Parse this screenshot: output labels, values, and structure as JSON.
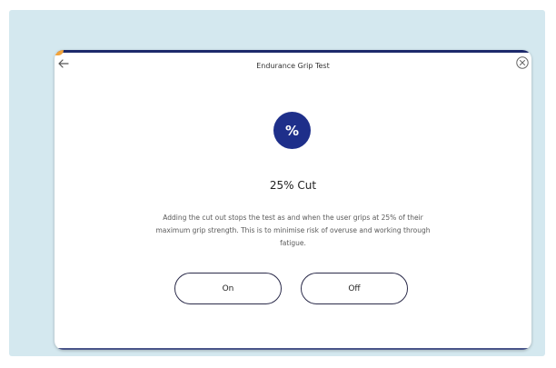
{
  "dialog": {
    "title": "Endurance Grip Test",
    "icon_symbol": "%",
    "heading": "25% Cut",
    "description": "Adding the cut out stops the test as and when the user grips at 25% of their maximum grip strength. This is to minimise risk of overuse and working through fatigue."
  },
  "options": {
    "on_label": "On",
    "off_label": "Off"
  },
  "colors": {
    "background": "#d4e8ef",
    "accent_navy": "#1e2f8a",
    "accent_orange": "#f2a33a"
  },
  "icons": {
    "back": "arrow-left-icon",
    "close": "close-circle-icon"
  }
}
